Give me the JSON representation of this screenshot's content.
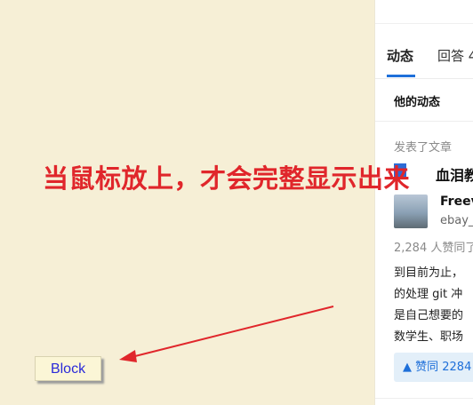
{
  "panel": {
    "tabs": [
      {
        "label": "动态"
      },
      {
        "label": "回答 4"
      }
    ],
    "section_title": "他的动态",
    "published_label": "发表了文章",
    "article_title": "血泪教",
    "author": {
      "name": "Freev",
      "subtitle": "ebay_"
    },
    "votes_text": "2,284 人赞同了",
    "excerpt_lines": [
      "到目前为止，",
      "的处理 git 冲",
      "是自己想要的",
      "数学生、职场"
    ],
    "upvote_label": "▲ 赞同 2284"
  },
  "annotation": {
    "headline": "当鼠标放上，才会完整显示出来",
    "arrow_color": "#e0262b"
  },
  "block_button": {
    "label": "Block"
  },
  "colors": {
    "background": "#f6efd6",
    "accent": "#1e6fd9",
    "annotation_red": "#e0262b"
  }
}
